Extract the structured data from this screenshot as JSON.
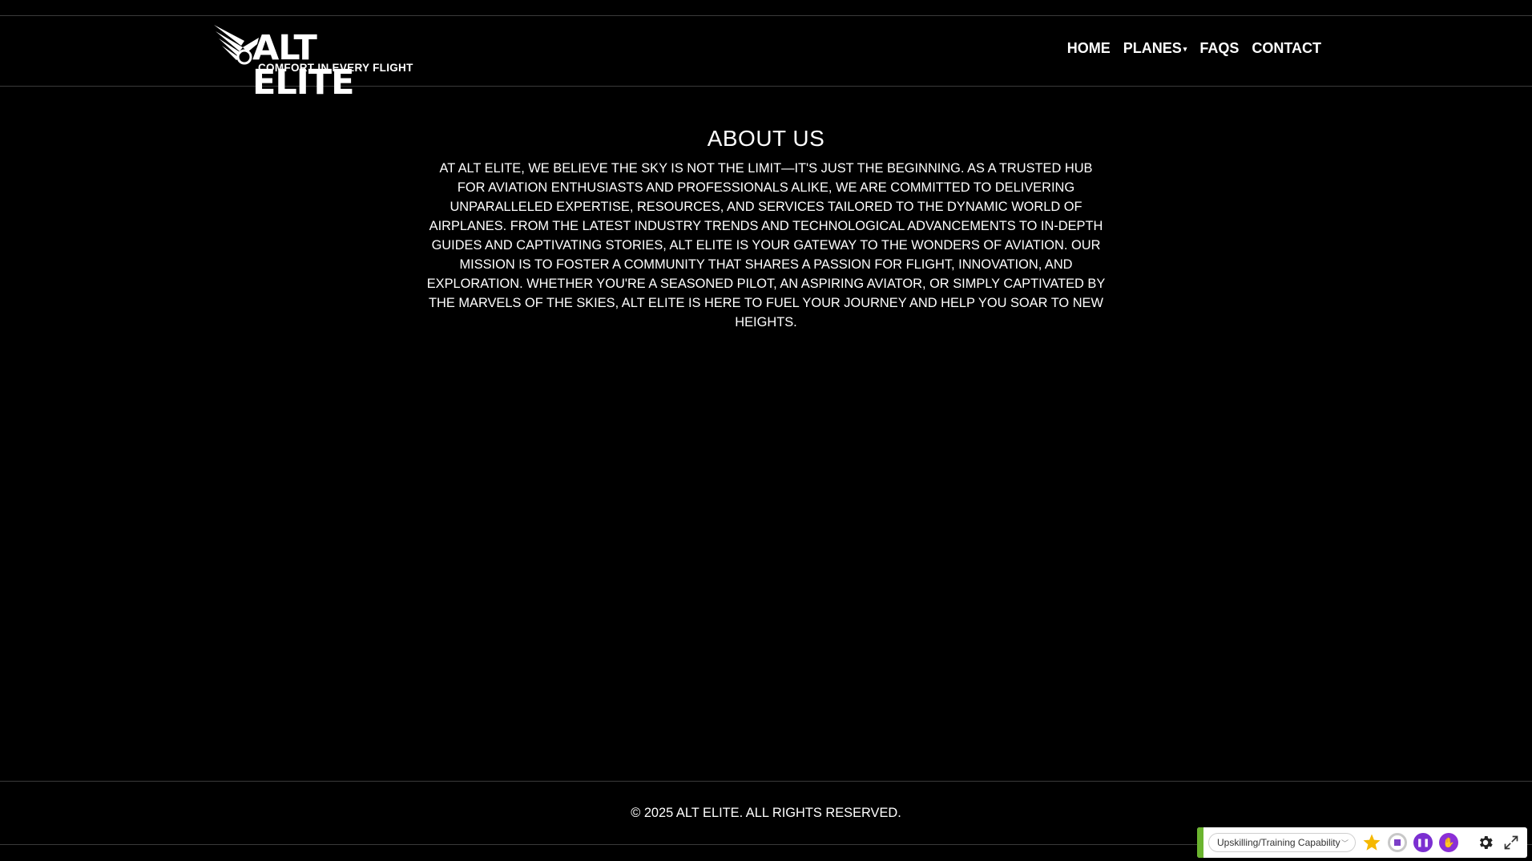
{
  "header": {
    "logo": {
      "title": "ALT ELITE",
      "tagline": "COMFORT IN EVERY FLIGHT"
    },
    "nav": [
      {
        "label": "HOME"
      },
      {
        "label": "PLANES",
        "has_dropdown": true
      },
      {
        "label": "FAQS"
      },
      {
        "label": "CONTACT"
      }
    ]
  },
  "main": {
    "title": "ABOUT US",
    "text": "AT ALT ELITE, WE BELIEVE THE SKY IS NOT THE LIMIT—IT'S JUST THE BEGINNING. AS A TRUSTED HUB FOR AVIATION ENTHUSIASTS AND PROFESSIONALS ALIKE, WE ARE COMMITTED TO DELIVERING UNPARALLELED EXPERTISE, RESOURCES, AND SERVICES TAILORED TO THE DYNAMIC WORLD OF AIRPLANES. FROM THE LATEST INDUSTRY TRENDS AND TECHNOLOGICAL ADVANCEMENTS TO IN-DEPTH GUIDES AND CAPTIVATING STORIES, ALT ELITE IS YOUR GATEWAY TO THE WONDERS OF AVIATION. OUR MISSION IS TO FOSTER A COMMUNITY THAT SHARES A PASSION FOR FLIGHT, INNOVATION, AND EXPLORATION. WHETHER YOU'RE A SEASONED PILOT, AN ASPIRING AVIATOR, OR SIMPLY CAPTIVATED BY THE MARVELS OF THE SKIES, ALT ELITE IS HERE TO FUEL YOUR JOURNEY AND HELP YOU SOAR TO NEW HEIGHTS."
  },
  "footer": {
    "copyright": "© 2025 ALT ELITE. ALL RIGHTS RESERVED."
  },
  "widget": {
    "select_value": "Upskilling/Training Capability",
    "icons": [
      "star-icon",
      "stop-icon",
      "pause-icon",
      "raise-hand-icon",
      "gear-icon",
      "expand-icon"
    ],
    "accent_color": "#6bb42f",
    "purple": "#7b2fd1"
  },
  "colors": {
    "background": "#000000",
    "text": "#ffffff",
    "divider": "#3a3a3a"
  }
}
